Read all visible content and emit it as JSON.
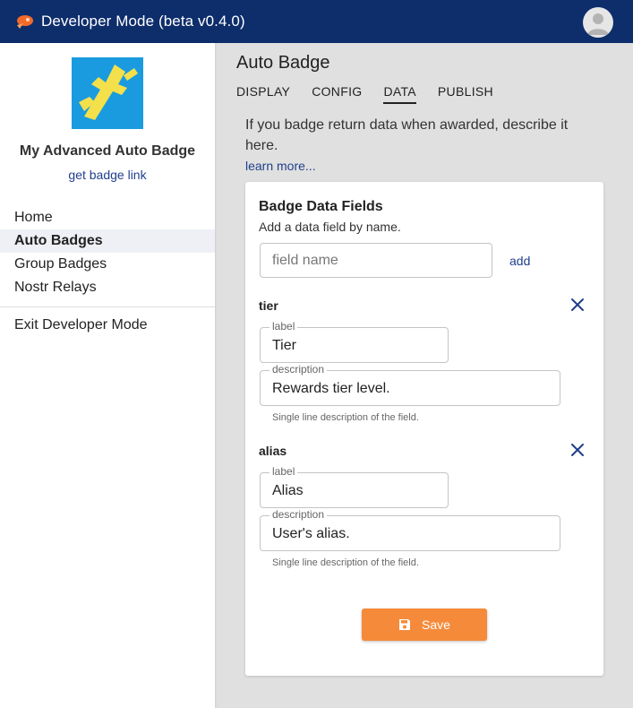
{
  "app": {
    "title": "Developer Mode (beta v0.4.0)",
    "logo_icon": "rocket-icon",
    "avatar_icon": "user-avatar-icon",
    "brand_color": "#0d2d6b"
  },
  "sidebar": {
    "badge_name": "My Advanced Auto Badge",
    "badge_link": "get badge link",
    "badge_image_color": "#1a9be0",
    "items": [
      {
        "label": "Home",
        "active": false
      },
      {
        "label": "Auto Badges",
        "active": true
      },
      {
        "label": "Group Badges",
        "active": false
      },
      {
        "label": "Nostr Relays",
        "active": false
      }
    ],
    "exit_label": "Exit Developer Mode"
  },
  "main": {
    "page_title": "Auto Badge",
    "tabs": [
      {
        "label": "DISPLAY",
        "active": false
      },
      {
        "label": "CONFIG",
        "active": false
      },
      {
        "label": "DATA",
        "active": true
      },
      {
        "label": "PUBLISH",
        "active": false
      }
    ],
    "intro": "If you badge return data when awarded, describe it here.",
    "learn_more": "learn more..."
  },
  "card": {
    "title": "Badge Data Fields",
    "subtitle": "Add a data field by name.",
    "input_placeholder": "field name",
    "add_label": "add",
    "fields": [
      {
        "name": "tier",
        "label_caption": "label",
        "label_value": "Tier",
        "description_caption": "description",
        "description_value": "Rewards tier level.",
        "helper": "Single line description of the field."
      },
      {
        "name": "alias",
        "label_caption": "label",
        "label_value": "Alias",
        "description_caption": "description",
        "description_value": "User's alias.",
        "helper": "Single line description of the field."
      }
    ],
    "save_label": "Save",
    "save_icon": "floppy-disk-icon",
    "accent_color": "#f58a3a"
  }
}
